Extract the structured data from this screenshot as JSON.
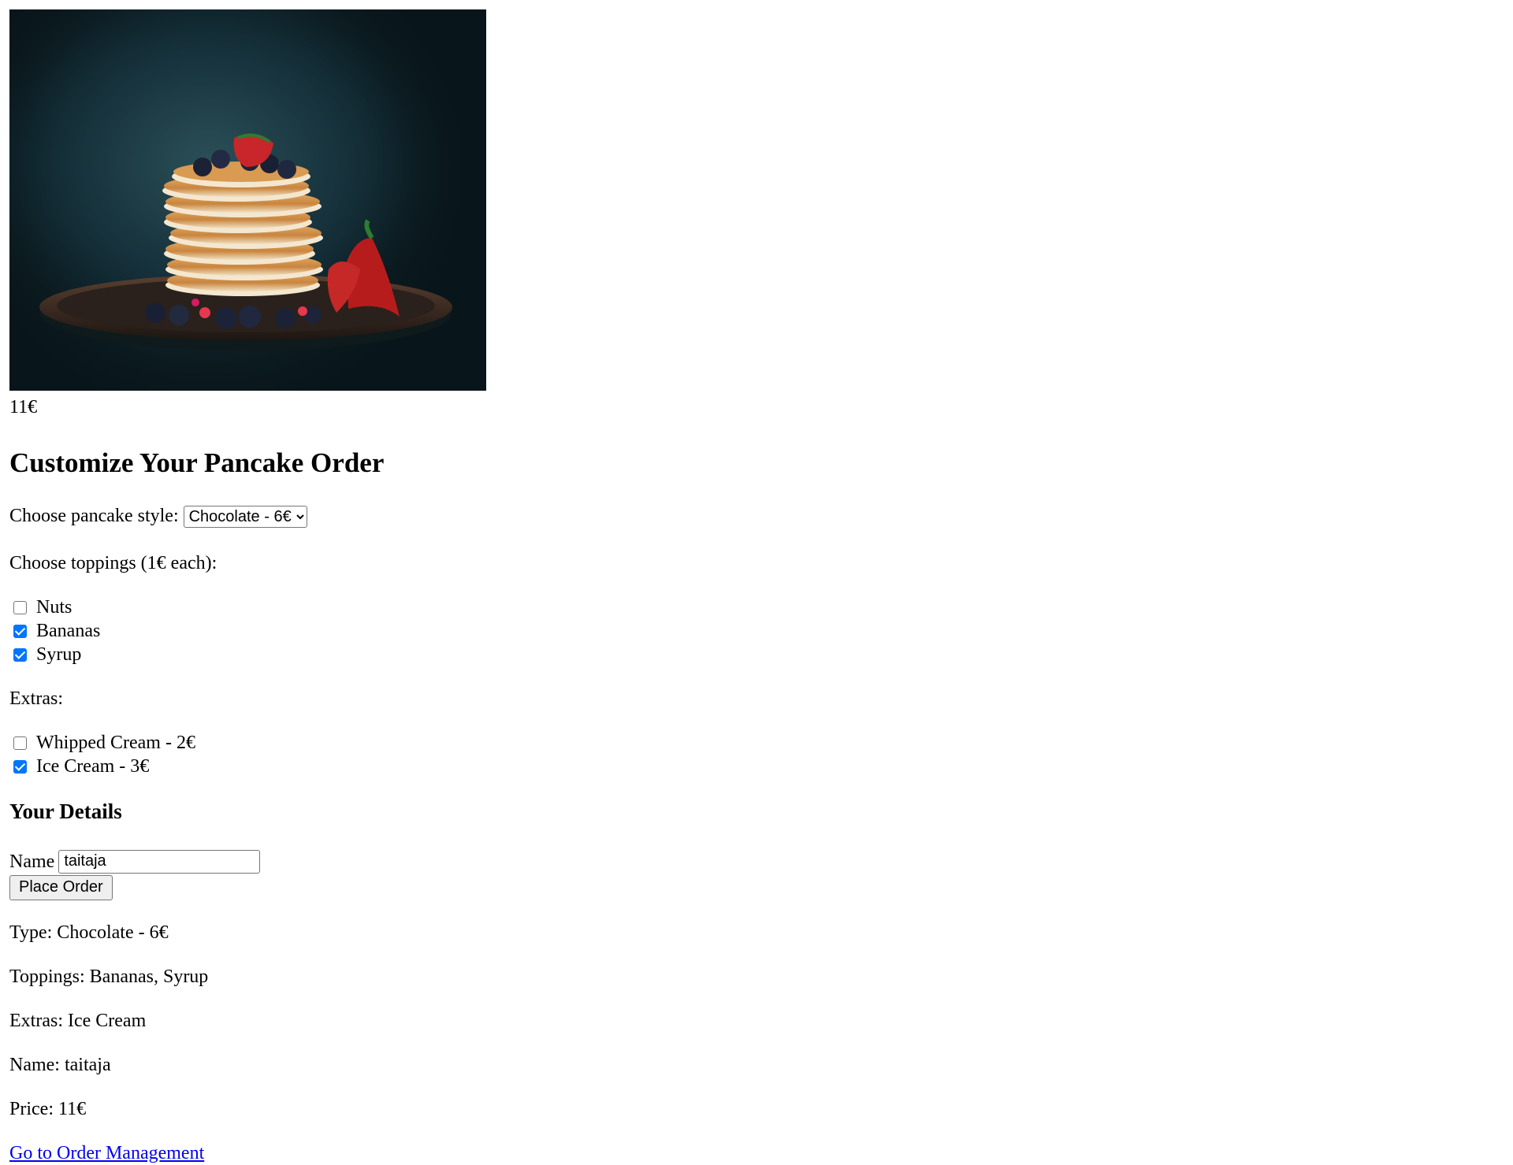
{
  "product": {
    "image_description": "Pancake stack with berries",
    "price": "11€"
  },
  "form": {
    "title": "Customize Your Pancake Order",
    "style_label": "Choose pancake style:",
    "style_selected": "Chocolate - 6€",
    "toppings_label": "Choose toppings (1€ each):",
    "toppings": [
      {
        "label": "Nuts",
        "checked": false
      },
      {
        "label": "Bananas",
        "checked": true
      },
      {
        "label": "Syrup",
        "checked": true
      }
    ],
    "extras_label": "Extras:",
    "extras": [
      {
        "label": "Whipped Cream - 2€",
        "checked": false
      },
      {
        "label": "Ice Cream - 3€",
        "checked": true
      }
    ]
  },
  "details": {
    "title": "Your Details",
    "name_label": "Name",
    "name_value": "taitaja",
    "submit_label": "Place Order"
  },
  "summary": {
    "type": "Type: Chocolate - 6€",
    "toppings": "Toppings: Bananas, Syrup",
    "extras": "Extras: Ice Cream",
    "name": "Name: taitaja",
    "price": "Price: 11€"
  },
  "link": {
    "label": "Go to Order Management"
  },
  "colors": {
    "link": "#0000ee",
    "checkbox_checked": "#0075ff",
    "image_background": "#16303a"
  }
}
